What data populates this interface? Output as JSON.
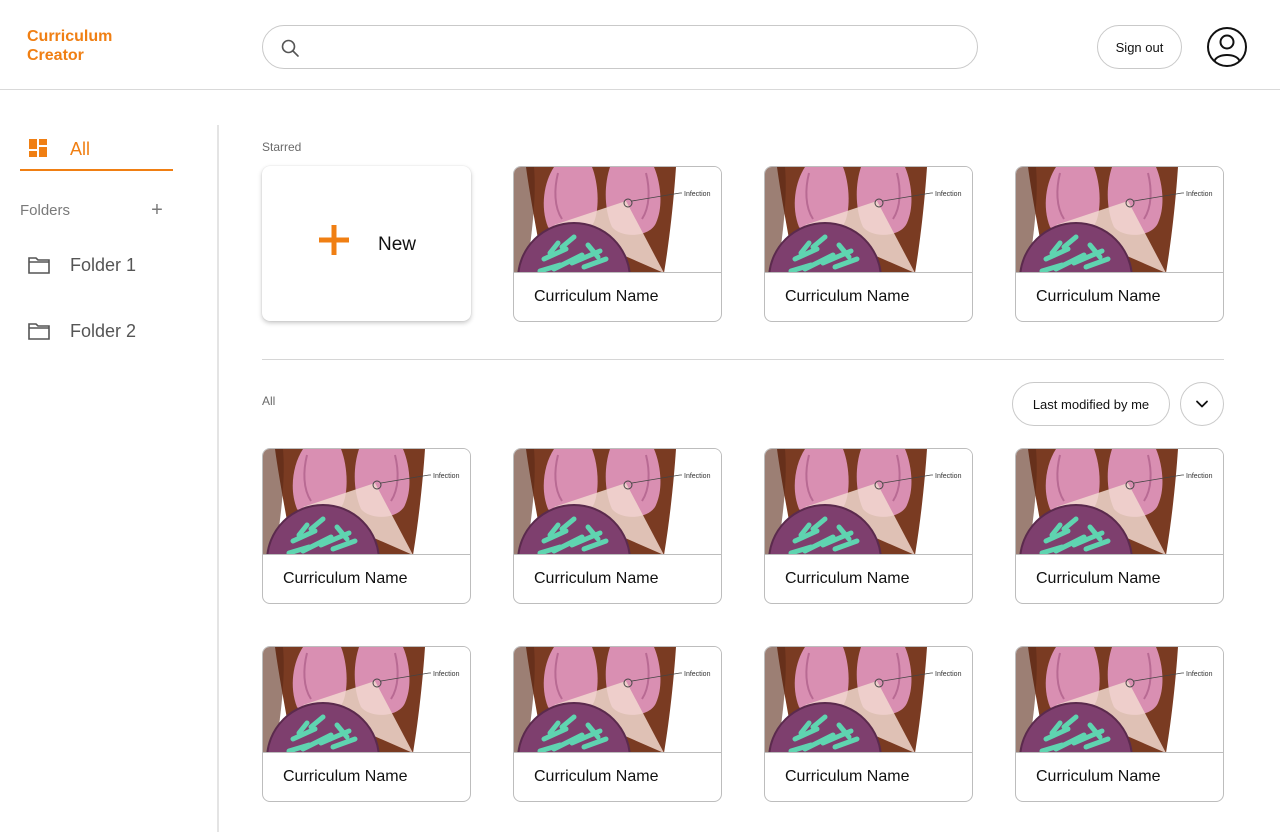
{
  "app": {
    "title": "Curriculum Creator",
    "accent": "#f07f13"
  },
  "header": {
    "search": {
      "value": "",
      "placeholder": "",
      "icon": "search-icon"
    },
    "sign_out_label": "Sign out",
    "avatar_icon": "user-circle-icon"
  },
  "sidebar": {
    "all_label": "All",
    "folders_label": "Folders",
    "add_folder_symbol": "+",
    "folders": [
      {
        "label": "Folder 1"
      },
      {
        "label": "Folder 2"
      }
    ]
  },
  "main": {
    "starred_label": "Starred",
    "new_label": "New",
    "all_label": "All",
    "sort_label": "Last modified by me",
    "thumbnail_annotation": "Infection",
    "starred_cards": [
      {
        "name": "Curriculum Name"
      },
      {
        "name": "Curriculum Name"
      },
      {
        "name": "Curriculum Name"
      }
    ],
    "all_cards": [
      {
        "name": "Curriculum Name"
      },
      {
        "name": "Curriculum Name"
      },
      {
        "name": "Curriculum Name"
      },
      {
        "name": "Curriculum Name"
      },
      {
        "name": "Curriculum Name"
      },
      {
        "name": "Curriculum Name"
      },
      {
        "name": "Curriculum Name"
      },
      {
        "name": "Curriculum Name"
      }
    ]
  }
}
